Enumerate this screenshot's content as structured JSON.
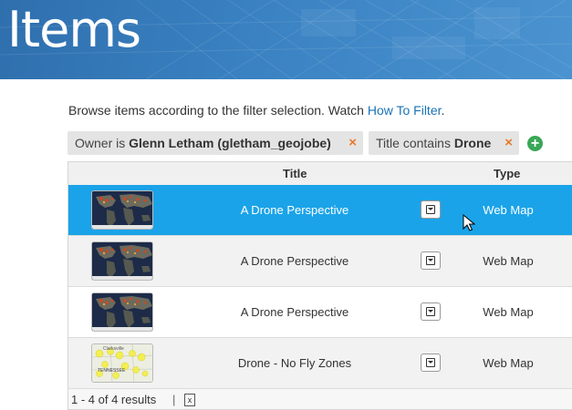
{
  "banner": {
    "title": "Items"
  },
  "intro": {
    "text": "Browse items according to the filter selection. Watch ",
    "link": "How To Filter",
    "period": "."
  },
  "filters": [
    {
      "prefix": "Owner is ",
      "value": "Glenn Letham (gletham_geojobe)",
      "remove_icon": "×"
    },
    {
      "prefix": "Title contains ",
      "value": "Drone",
      "remove_icon": "×"
    }
  ],
  "add_filter_icon": "+",
  "table": {
    "columns": {
      "title": "Title",
      "type": "Type"
    },
    "rows": [
      {
        "title": "A Drone Perspective",
        "type": "Web Map",
        "thumbnail": "world-map-thumbnail",
        "selected": true
      },
      {
        "title": "A Drone Perspective",
        "type": "Web Map",
        "thumbnail": "world-map-thumbnail",
        "selected": false
      },
      {
        "title": "A Drone Perspective",
        "type": "Web Map",
        "thumbnail": "world-map-thumbnail",
        "selected": false
      },
      {
        "title": "Drone - No Fly Zones",
        "type": "Web Map",
        "thumbnail": "tennessee-map-thumbnail",
        "selected": false
      }
    ]
  },
  "tn_thumb": {
    "label1": "Clarksville",
    "label2": "TENNESSEE"
  },
  "footer": {
    "results": "1 - 4 of 4 results",
    "separator": "|",
    "export_icon": "x"
  },
  "colors": {
    "selected_row": "#1aa3e8",
    "link": "#1a73b8",
    "remove": "#e8792b",
    "add": "#3aa757"
  }
}
